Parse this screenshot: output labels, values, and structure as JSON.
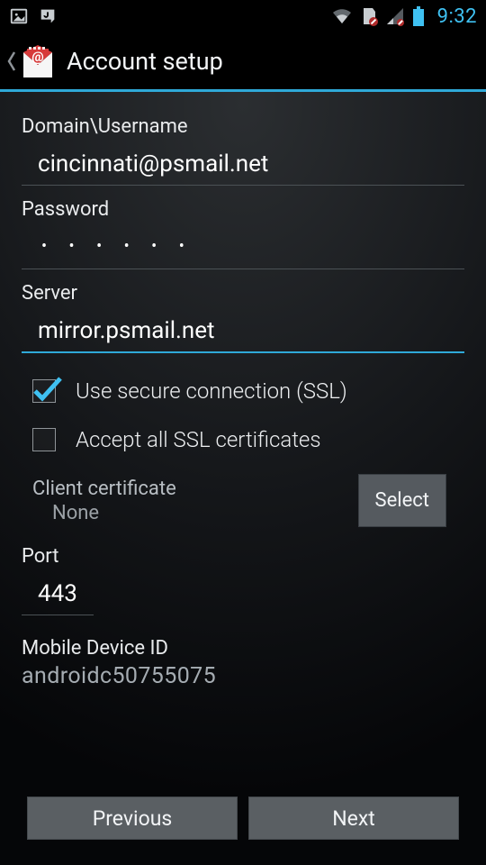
{
  "status": {
    "time": "9:32"
  },
  "appbar": {
    "title": "Account setup"
  },
  "labels": {
    "domain_user": "Domain\\Username",
    "password": "Password",
    "server": "Server",
    "ssl": "Use secure connection (SSL)",
    "accept_all": "Accept all SSL certificates",
    "client_cert": "Client certificate",
    "client_cert_value": "None",
    "select": "Select",
    "port": "Port",
    "device_id": "Mobile Device ID"
  },
  "values": {
    "domain_user": "cincinnati@psmail.net",
    "password_mask": "• • • • • •",
    "server": "mirror.psmail.net",
    "port": "443",
    "device_id": "androidc50755075",
    "ssl_checked": true,
    "accept_all_checked": false
  },
  "buttons": {
    "previous": "Previous",
    "next": "Next"
  }
}
